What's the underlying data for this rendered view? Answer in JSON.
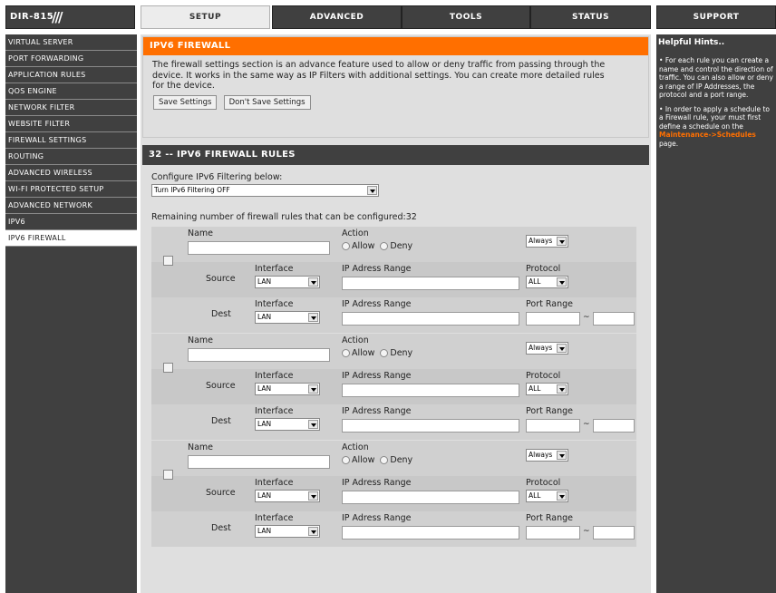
{
  "header": {
    "model": "DIR-815",
    "model_slash": "///",
    "tabs": [
      "SETUP",
      "ADVANCED",
      "TOOLS",
      "STATUS",
      "SUPPORT"
    ]
  },
  "sidebar": {
    "items": [
      "VIRTUAL SERVER",
      "PORT FORWARDING",
      "APPLICATION RULES",
      "QOS ENGINE",
      "NETWORK FILTER",
      "WEBSITE FILTER",
      "FIREWALL SETTINGS",
      "ROUTING",
      "ADVANCED WIRELESS",
      "WI-FI PROTECTED SETUP",
      "ADVANCED NETWORK",
      "IPV6",
      "IPV6 FIREWALL"
    ],
    "active_index": 12
  },
  "intro": {
    "title": "IPV6 FIREWALL",
    "text": "The firewall settings section is an advance feature used to allow or deny traffic from passing through the device. It works in the same way as IP Filters with additional settings. You can create more detailed rules for the device.",
    "save_label": "Save Settings",
    "dont_save_label": "Don't Save Settings"
  },
  "rules": {
    "title": "32 -- IPV6 FIREWALL RULES",
    "configure_label": "Configure IPv6 Filtering below:",
    "filter_value": "Turn IPv6 Filtering OFF",
    "remaining_label": "Remaining number of firewall rules that can be configured:32",
    "labels": {
      "name": "Name",
      "action": "Action",
      "allow": "Allow",
      "deny": "Deny",
      "schedule": "Always",
      "source": "Source",
      "dest": "Dest",
      "interface": "Interface",
      "interface_value": "LAN",
      "ip_range": "IP Adress Range",
      "protocol": "Protocol",
      "protocol_value": "ALL",
      "port_range": "Port Range",
      "tilde": "~"
    }
  },
  "help": {
    "title": "Helpful Hints..",
    "hint1": "For each rule you can create a name and control the direction of traffic. You can also allow or deny a range of IP Addresses, the protocol and a port range.",
    "hint2_pre": "In order to apply a schedule to a Firewall rule, your must first define a schedule on the",
    "hint2_link": "Maintenance->Schedules",
    "hint2_post": "page."
  }
}
